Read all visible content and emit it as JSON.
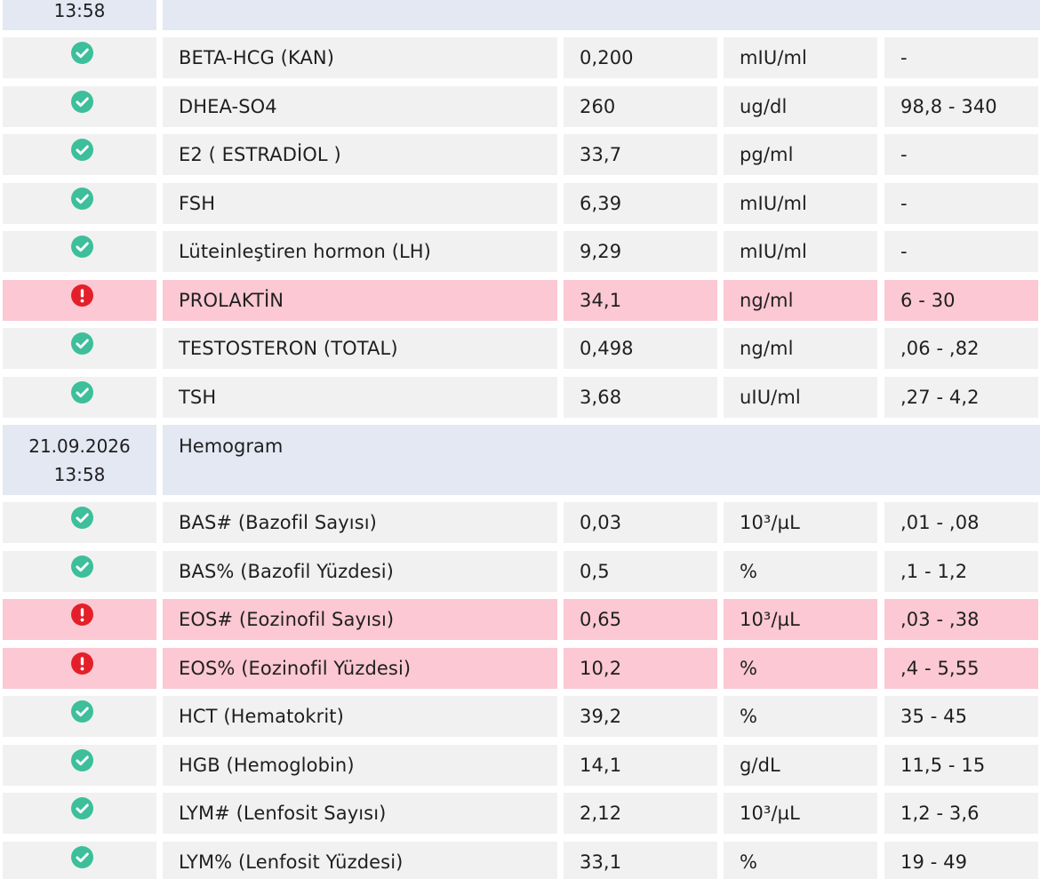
{
  "top_group": {
    "time": "13:58"
  },
  "groups": [
    {
      "rows": [
        {
          "name": "BETA-HCG (KAN)",
          "value": "0,200",
          "unit": "mIU/ml",
          "ref": "-",
          "status": "normal",
          "status_icon": "check-circle-icon"
        },
        {
          "name": "DHEA-SO4",
          "value": "260",
          "unit": "ug/dl",
          "ref": "98,8 - 340",
          "status": "normal",
          "status_icon": "check-circle-icon"
        },
        {
          "name": "E2 ( ESTRADİOL )",
          "value": "33,7",
          "unit": "pg/ml",
          "ref": "-",
          "status": "normal",
          "status_icon": "check-circle-icon"
        },
        {
          "name": "FSH",
          "value": "6,39",
          "unit": "mIU/ml",
          "ref": "-",
          "status": "normal",
          "status_icon": "check-circle-icon"
        },
        {
          "name": "Lüteinleştiren hormon (LH)",
          "value": "9,29",
          "unit": "mIU/ml",
          "ref": "-",
          "status": "normal",
          "status_icon": "check-circle-icon"
        },
        {
          "name": "PROLAKTİN",
          "value": "34,1",
          "unit": "ng/ml",
          "ref": "6 - 30",
          "status": "abnormal",
          "status_icon": "alert-circle-icon"
        },
        {
          "name": "TESTOSTERON (TOTAL)",
          "value": "0,498",
          "unit": "ng/ml",
          "ref": ",06 - ,82",
          "status": "normal",
          "status_icon": "check-circle-icon"
        },
        {
          "name": "TSH",
          "value": "3,68",
          "unit": "uIU/ml",
          "ref": ",27 - 4,2",
          "status": "normal",
          "status_icon": "check-circle-icon"
        }
      ]
    },
    {
      "date": "21.09.2026",
      "time": "13:58",
      "title": "Hemogram",
      "rows": [
        {
          "name": "BAS# (Bazofil Sayısı)",
          "value": "0,03",
          "unit": "10³/µL",
          "ref": ",01 - ,08",
          "status": "normal",
          "status_icon": "check-circle-icon"
        },
        {
          "name": "BAS% (Bazofil Yüzdesi)",
          "value": "0,5",
          "unit": "%",
          "ref": ",1 - 1,2",
          "status": "normal",
          "status_icon": "check-circle-icon"
        },
        {
          "name": "EOS# (Eozinofil Sayısı)",
          "value": "0,65",
          "unit": "10³/µL",
          "ref": ",03 - ,38",
          "status": "abnormal",
          "status_icon": "alert-circle-icon"
        },
        {
          "name": "EOS% (Eozinofil Yüzdesi)",
          "value": "10,2",
          "unit": "%",
          "ref": ",4 - 5,55",
          "status": "abnormal",
          "status_icon": "alert-circle-icon"
        },
        {
          "name": "HCT (Hematokrit)",
          "value": "39,2",
          "unit": "%",
          "ref": "35 - 45",
          "status": "normal",
          "status_icon": "check-circle-icon"
        },
        {
          "name": "HGB (Hemoglobin)",
          "value": "14,1",
          "unit": "g/dL",
          "ref": "11,5 - 15",
          "status": "normal",
          "status_icon": "check-circle-icon"
        },
        {
          "name": "LYM# (Lenfosit Sayısı)",
          "value": "2,12",
          "unit": "10³/µL",
          "ref": "1,2 - 3,6",
          "status": "normal",
          "status_icon": "check-circle-icon"
        },
        {
          "name": "LYM% (Lenfosit Yüzdesi)",
          "value": "33,1",
          "unit": "%",
          "ref": "19 - 49",
          "status": "normal",
          "status_icon": "check-circle-icon"
        }
      ]
    }
  ],
  "colors": {
    "normal_icon": "#3cbf9a",
    "abnormal_icon": "#e3202a",
    "normal_row": "#f1f1f1",
    "abnormal_row": "#fbc8d3",
    "group_header": "#e3e8f3"
  }
}
